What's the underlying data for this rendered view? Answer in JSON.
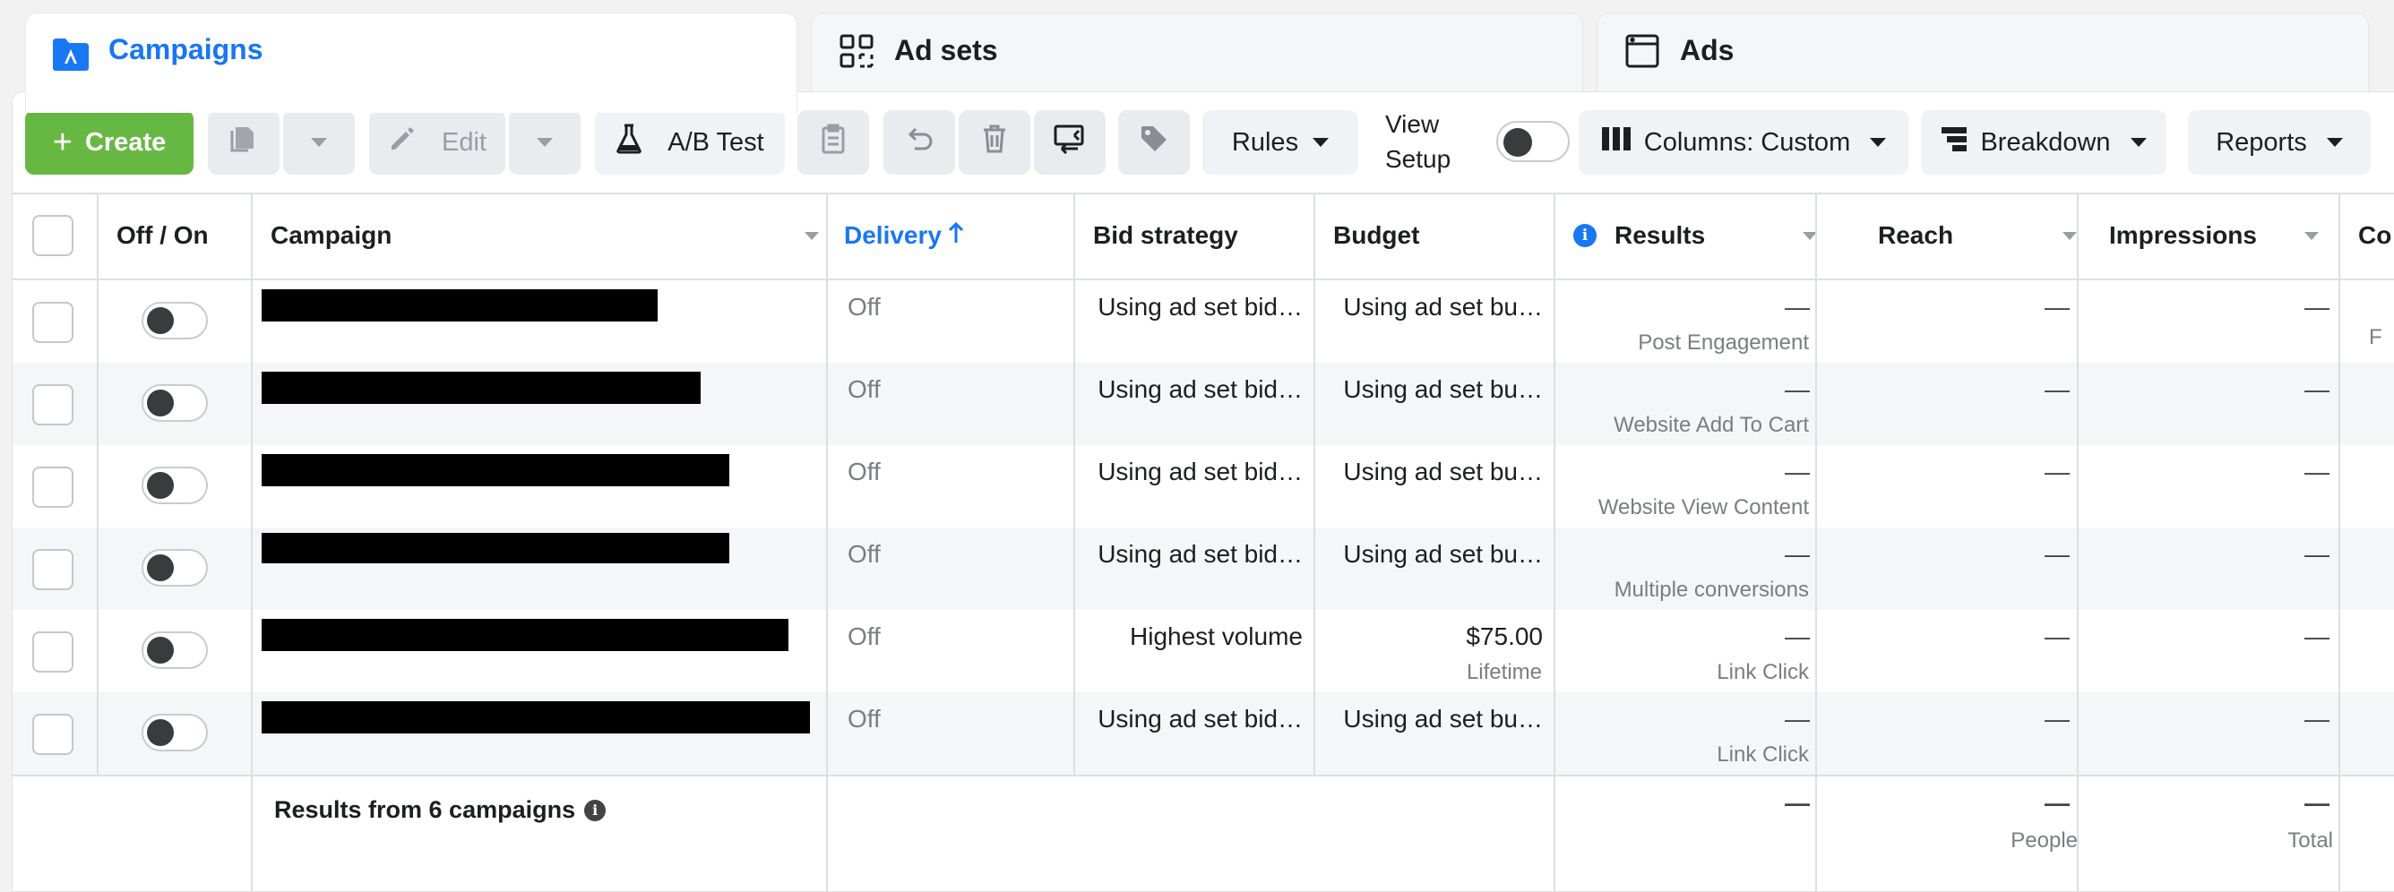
{
  "tabs": [
    {
      "label": "Campaigns",
      "icon": "folder-campaign-icon",
      "active": true
    },
    {
      "label": "Ad sets",
      "icon": "grid-icon"
    },
    {
      "label": "Ads",
      "icon": "ad-window-icon"
    }
  ],
  "toolbar": {
    "create_label": "Create",
    "edit_label": "Edit",
    "ab_test_label": "A/B Test",
    "rules_label": "Rules",
    "view_setup_label": "View Setup",
    "view_setup_line1": "View",
    "view_setup_line2": "Setup",
    "columns_label": "Columns: Custom",
    "breakdown_label": "Breakdown",
    "reports_label": "Reports"
  },
  "table": {
    "headers": {
      "off_on": "Off / On",
      "campaign": "Campaign",
      "delivery": "Delivery",
      "bid_strategy": "Bid strategy",
      "budget": "Budget",
      "results": "Results",
      "reach": "Reach",
      "impressions": "Impressions",
      "cost_truncated": "Co"
    },
    "rows": [
      {
        "delivery": "Off",
        "bid": "Using ad set bid…",
        "budget": "Using ad set bu…",
        "budget_sub": "",
        "result": "—",
        "result_sub": "Post Engagement",
        "reach": "—",
        "impressions": "—",
        "cost_sub": "F"
      },
      {
        "delivery": "Off",
        "bid": "Using ad set bid…",
        "budget": "Using ad set bu…",
        "budget_sub": "",
        "result": "—",
        "result_sub": "Website Add To Cart",
        "reach": "—",
        "impressions": "—",
        "cost_sub": ""
      },
      {
        "delivery": "Off",
        "bid": "Using ad set bid…",
        "budget": "Using ad set bu…",
        "budget_sub": "",
        "result": "—",
        "result_sub": "Website View Content",
        "reach": "—",
        "impressions": "—",
        "cost_sub": ""
      },
      {
        "delivery": "Off",
        "bid": "Using ad set bid…",
        "budget": "Using ad set bu…",
        "budget_sub": "",
        "result": "—",
        "result_sub": "Multiple conversions",
        "reach": "—",
        "impressions": "—",
        "cost_sub": ""
      },
      {
        "delivery": "Off",
        "bid": "Highest volume",
        "budget": "$75.00",
        "budget_sub": "Lifetime",
        "result": "—",
        "result_sub": "Link Click",
        "reach": "—",
        "impressions": "—",
        "cost_sub": ""
      },
      {
        "delivery": "Off",
        "bid": "Using ad set bid…",
        "budget": "Using ad set bu…",
        "budget_sub": "",
        "result": "—",
        "result_sub": "Link Click",
        "reach": "—",
        "impressions": "—",
        "cost_sub": ""
      }
    ],
    "footer": {
      "label": "Results from 6 campaigns",
      "results": "—",
      "reach": "—",
      "reach_sub": "People",
      "impressions": "—",
      "impressions_sub": "Total"
    }
  },
  "colors": {
    "accent": "#1877f2",
    "create_green": "#67b843",
    "row_alt": "#f5f6f7"
  }
}
